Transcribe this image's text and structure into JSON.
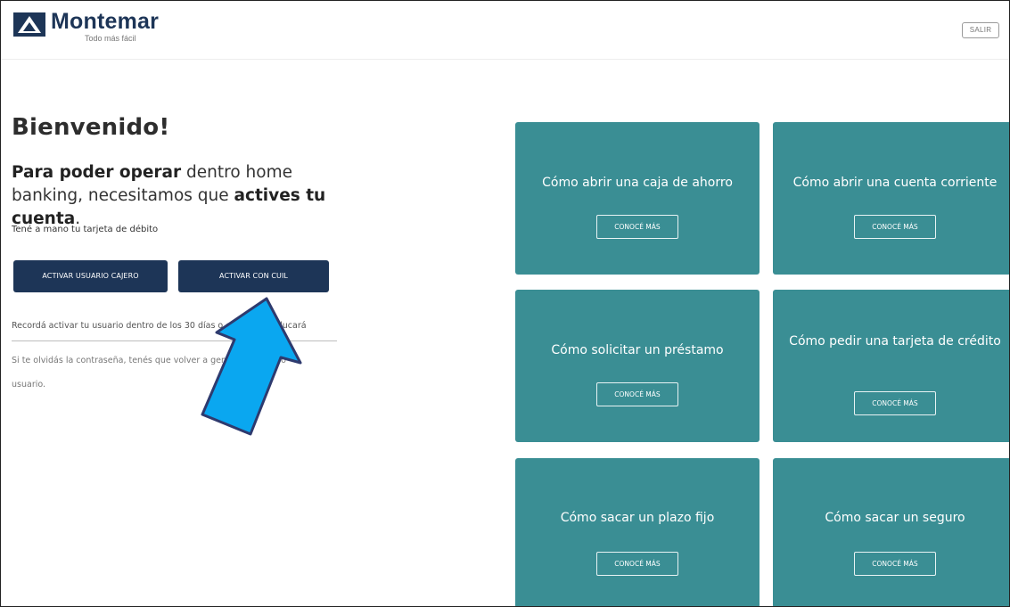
{
  "header": {
    "brand_name": "Montemar",
    "brand_tagline": "Todo más fácil",
    "exit_label": "SALIR"
  },
  "main": {
    "welcome": "Bienvenido!",
    "lead_bold_1": "Para poder operar",
    "lead_text_1": " dentro home banking, necesitamos que ",
    "lead_bold_2": "actives tu cuenta",
    "lead_text_2": ".",
    "hint": "Tené a mano tu tarjeta de débito",
    "btn_cajero": "ACTIVAR USUARIO CAJERO",
    "btn_cuil": "ACTIVAR CON CUIL",
    "reminder": "Recordá activar tu usuario dentro de los 30 días o el mismo caducará",
    "forgot": "Si te olvidás la contraseña, tenés que volver a generar un nuevo usuario."
  },
  "cards": [
    {
      "title": "Cómo abrir una caja de ahorro",
      "button": "CONOCÉ MÁS"
    },
    {
      "title": "Cómo abrir una cuenta corriente",
      "button": "CONOCÉ MÁS"
    },
    {
      "title": "Cómo solicitar un préstamo",
      "button": "CONOCÉ MÁS"
    },
    {
      "title": "Cómo pedir una tarjeta de crédito",
      "button": "CONOCÉ MÁS"
    },
    {
      "title": "Cómo sacar un plazo fijo",
      "button": "CONOCÉ MÁS"
    },
    {
      "title": "Cómo sacar un seguro",
      "button": "CONOCÉ MÁS"
    }
  ],
  "colors": {
    "brand_navy": "#1d3557",
    "card_teal": "#3a8e94",
    "arrow_blue": "#0aa7f0"
  },
  "icons": {
    "logo": "mountain-logo-icon",
    "pointer": "arrow-annotation-icon"
  }
}
